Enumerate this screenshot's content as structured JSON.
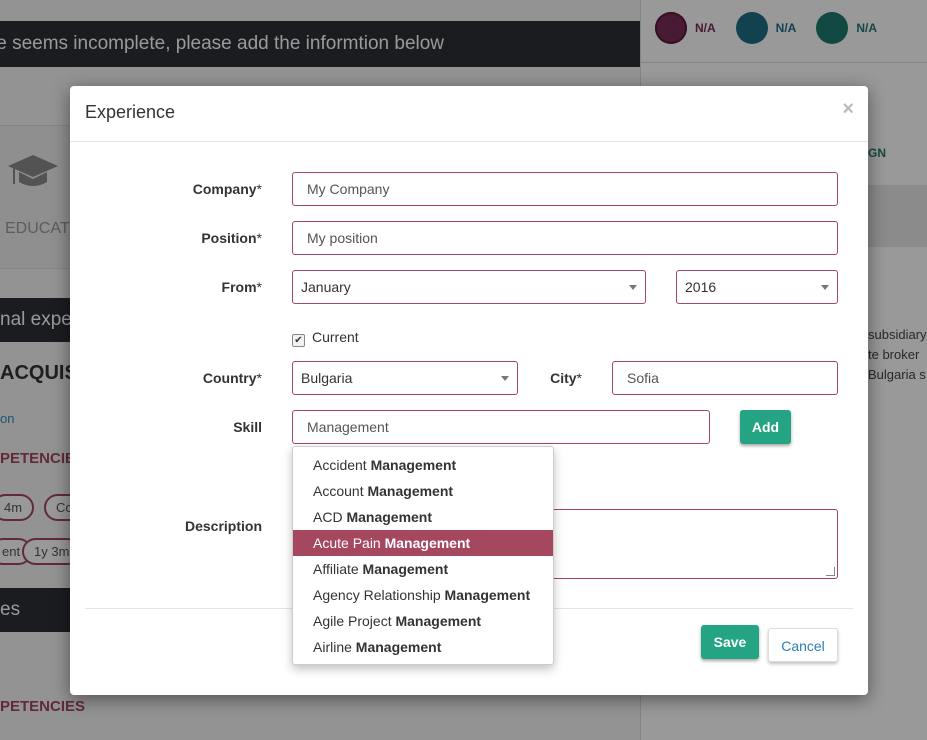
{
  "background": {
    "banner_text": "le seems incomplete, please add the informtion below",
    "status_icons": [
      {
        "icon": "user-badge-icon",
        "value": "N/A",
        "color": "#7a2c55"
      },
      {
        "icon": "user-group-icon",
        "value": "N/A",
        "color": "#1f6f86"
      },
      {
        "icon": "folder-icon",
        "value": "N/A",
        "color": "#1e7a70"
      }
    ],
    "education_label": "EDUCAT",
    "section_dark_text": "nal expe",
    "company_heading": "ACQUIS",
    "link_text": "on",
    "competencies_label": "PETENCIES",
    "pills": [
      "4m",
      "Co"
    ],
    "pill_row2": [
      "ent",
      "1y 3m"
    ],
    "section_dark2_text": "es",
    "competencies_label2": "PETENCIES",
    "right_gn": "GN",
    "right_text_lines": [
      "subsidiary",
      "te broker",
      "Bulgaria s"
    ]
  },
  "modal": {
    "title": "Experience",
    "close": "×",
    "company": {
      "label": "Company",
      "required": "*",
      "value": "My Company"
    },
    "position": {
      "label": "Position",
      "required": "*",
      "value": "My position"
    },
    "from": {
      "label": "From",
      "required": "*",
      "month": "January",
      "year": "2016"
    },
    "current": {
      "label": "Current",
      "checked": true,
      "mark": "✔"
    },
    "country": {
      "label": "Country",
      "required": "*",
      "value": "Bulgaria"
    },
    "city": {
      "label": "City",
      "required": "*",
      "value": "Sofia"
    },
    "skill": {
      "label": "Skill",
      "value": "Management"
    },
    "add_button": "Add",
    "description": {
      "label": "Description",
      "value": ""
    },
    "save_button": "Save",
    "cancel_button": "Cancel"
  },
  "autocomplete": {
    "items": [
      {
        "prefix": "Accident ",
        "match": "Management"
      },
      {
        "prefix": "Account ",
        "match": "Management"
      },
      {
        "prefix": "ACD ",
        "match": "Management"
      },
      {
        "prefix": "Acute Pain ",
        "match": "Management",
        "active": true
      },
      {
        "prefix": "Affiliate ",
        "match": "Management"
      },
      {
        "prefix": "Agency Relationship ",
        "match": "Management"
      },
      {
        "prefix": "Agile Project ",
        "match": "Management"
      },
      {
        "prefix": "Airline ",
        "match": "Management"
      }
    ]
  },
  "colors": {
    "accent": "#a4475f",
    "button_green": "#24a483",
    "link_blue": "#2a7fb5"
  }
}
